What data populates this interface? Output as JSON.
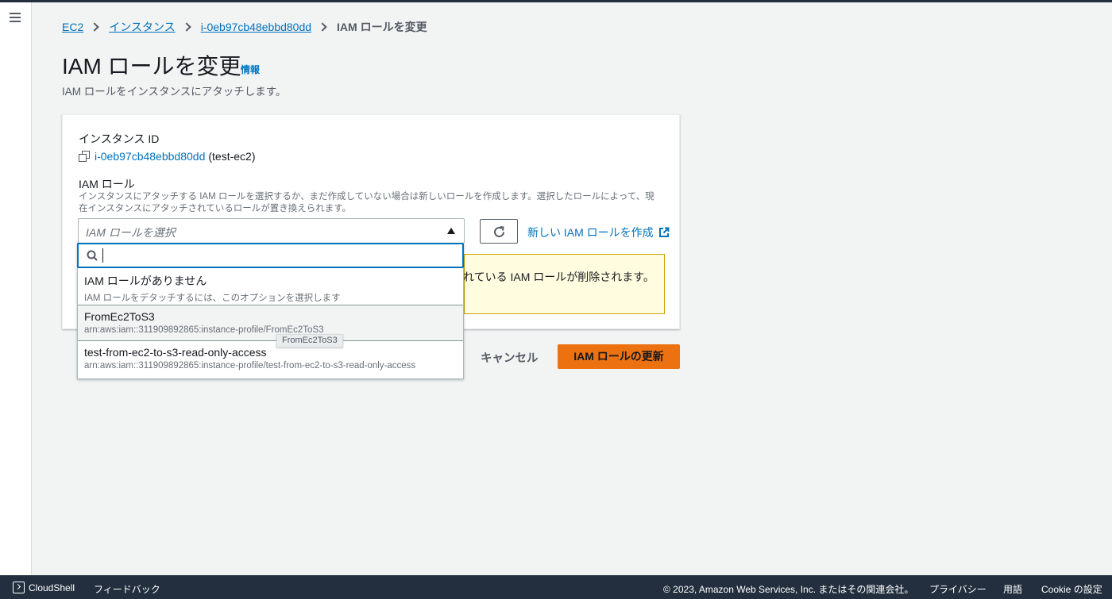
{
  "breadcrumb": {
    "ec2": "EC2",
    "instances": "インスタンス",
    "instance_id": "i-0eb97cb48ebbd80dd",
    "current": "IAM ロールを変更"
  },
  "page": {
    "title": "IAM ロールを変更",
    "info": "情報",
    "description": "IAM ロールをインスタンスにアタッチします。"
  },
  "form": {
    "instance_label": "インスタンス ID",
    "instance_id": "i-0eb97cb48ebbd80dd",
    "instance_name": "(test-ec2)",
    "role_label": "IAM ロール",
    "role_desc_line1": "インスタンスにアタッチする IAM ロールを選択するか、まだ作成していない場合は新しいロールを作成します。選択したロールによって、現",
    "role_desc_line2": "在インスタンスにアタッチされているロールが置き換えられます。",
    "select_placeholder": "IAM ロールを選択",
    "create_link": "新しい IAM ロールを作成",
    "warning_text": "れている IAM ロールが削除されます。"
  },
  "dropdown": {
    "search_value": "",
    "options": [
      {
        "label": "IAM ロールがありません",
        "desc": "IAM ロールをデタッチするには、このオプションを選択します"
      },
      {
        "label": "FromEc2ToS3",
        "desc": "arn:aws:iam::311909892865:instance-profile/FromEc2ToS3"
      },
      {
        "label": "test-from-ec2-to-s3-read-only-access",
        "desc": "arn:aws:iam::311909892865:instance-profile/test-from-ec2-to-s3-read-only-access"
      }
    ],
    "tooltip": "FromEc2ToS3"
  },
  "actions": {
    "cancel": "キャンセル",
    "submit": "IAM ロールの更新"
  },
  "footer": {
    "cloudshell": "CloudShell",
    "feedback": "フィードバック",
    "copyright": "© 2023, Amazon Web Services, Inc. またはその関連会社。",
    "privacy": "プライバシー",
    "terms": "用語",
    "cookie": "Cookie の設定"
  },
  "colors": {
    "link": "#0073bb",
    "primary": "#ec7211",
    "footer_bg": "#232f3e"
  }
}
